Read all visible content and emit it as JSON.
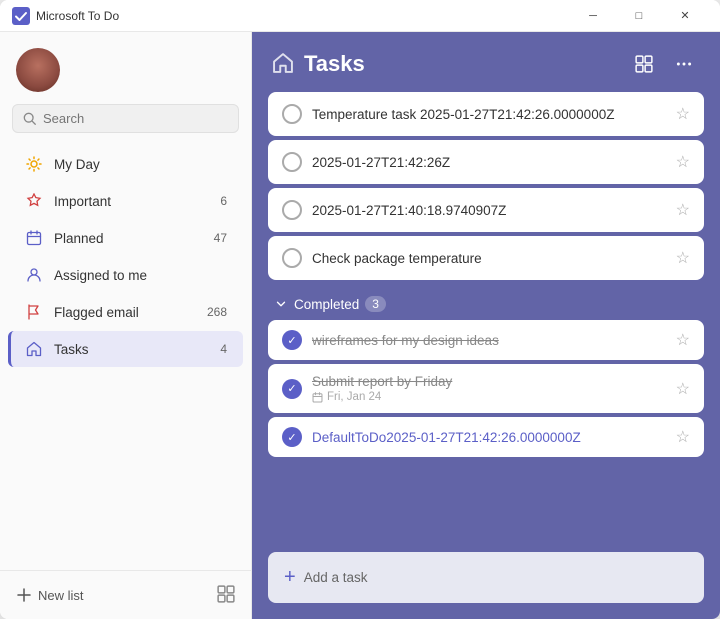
{
  "app": {
    "title": "Microsoft To Do",
    "window_controls": {
      "minimize": "─",
      "maximize": "□",
      "close": "✕"
    }
  },
  "sidebar": {
    "search_placeholder": "Search",
    "nav_items": [
      {
        "id": "my-day",
        "label": "My Day",
        "icon": "sun",
        "count": null
      },
      {
        "id": "important",
        "label": "Important",
        "icon": "star",
        "count": "6"
      },
      {
        "id": "planned",
        "label": "Planned",
        "icon": "calendar",
        "count": "47"
      },
      {
        "id": "assigned",
        "label": "Assigned to me",
        "icon": "person",
        "count": null
      },
      {
        "id": "flagged",
        "label": "Flagged email",
        "icon": "flag",
        "count": "268"
      },
      {
        "id": "tasks",
        "label": "Tasks",
        "icon": "home",
        "count": "4",
        "active": true
      }
    ],
    "new_list_label": "New list"
  },
  "panel": {
    "title": "Tasks",
    "tasks": [
      {
        "id": 1,
        "text": "Temperature task 2025-01-27T21:42:26.0000000Z",
        "starred": false
      },
      {
        "id": 2,
        "text": "2025-01-27T21:42:26Z",
        "starred": false
      },
      {
        "id": 3,
        "text": "2025-01-27T21:40:18.9740907Z",
        "starred": false
      },
      {
        "id": 4,
        "text": "Check package temperature",
        "starred": false
      }
    ],
    "completed": {
      "label": "Completed",
      "count": "3",
      "items": [
        {
          "id": 1,
          "text": "wireframes for my design ideas",
          "sub": null,
          "link": false,
          "starred": false
        },
        {
          "id": 2,
          "text": "Submit report by Friday",
          "sub": "Fri, Jan 24",
          "link": false,
          "starred": false
        },
        {
          "id": 3,
          "text": "DefaultToDo2025-01-27T21:42:26.0000000Z",
          "sub": null,
          "link": true,
          "starred": false
        }
      ]
    },
    "add_task_label": "Add a task"
  }
}
